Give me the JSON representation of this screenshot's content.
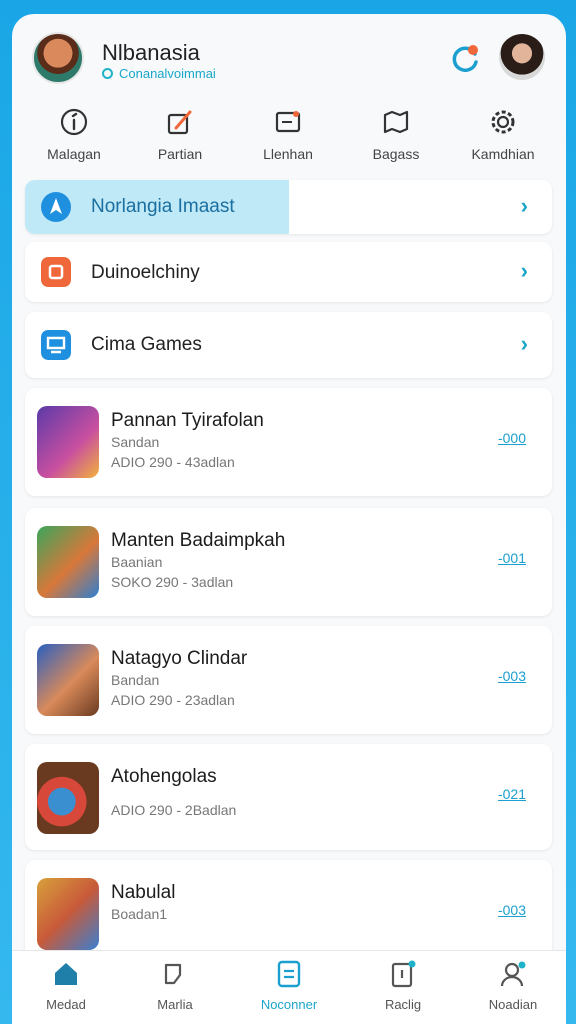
{
  "header": {
    "title": "Nlbanasia",
    "subtitle": "Conanalvoimmai"
  },
  "topnav": [
    {
      "label": "Malagan",
      "icon": "info-icon"
    },
    {
      "label": "Partian",
      "icon": "edit-icon"
    },
    {
      "label": "Llenhan",
      "icon": "message-icon"
    },
    {
      "label": "Bagass",
      "icon": "map-icon"
    },
    {
      "label": "Kamdhian",
      "icon": "gear-icon"
    }
  ],
  "menu": [
    {
      "label": "Norlangia Imaast",
      "icon": "rocket-icon",
      "color": "#1f8fe0"
    },
    {
      "label": "Duinoelchiny",
      "icon": "square-icon",
      "color": "#f0683a"
    },
    {
      "label": "Cima Games",
      "icon": "screen-icon",
      "color": "#1f8fe0"
    }
  ],
  "games": [
    {
      "title": "Pannan Tyirafolan",
      "sub": "Sandan",
      "meta": "ADIO 290 - 43adlan",
      "value": "-000"
    },
    {
      "title": "Manten Badaimpkah",
      "sub": "Baanian",
      "meta": "SOKO 290 - 3adlan",
      "value": "-001"
    },
    {
      "title": "Natagyo Clindar",
      "sub": "Bandan",
      "meta": "ADIO 290 - 23adlan",
      "value": "-003"
    },
    {
      "title": "Atohengolas",
      "sub": "",
      "meta": "ADIO 290 - 2Badlan",
      "value": "-021"
    },
    {
      "title": "Nabulal",
      "sub": "Boadan1",
      "meta": "",
      "value": "-003"
    }
  ],
  "bottomnav": [
    {
      "label": "Medad",
      "icon": "home-icon"
    },
    {
      "label": "Marlia",
      "icon": "cards-icon"
    },
    {
      "label": "Noconner",
      "icon": "list-icon"
    },
    {
      "label": "Raclig",
      "icon": "tablet-icon"
    },
    {
      "label": "Noadian",
      "icon": "profile-icon"
    }
  ],
  "colors": {
    "accent": "#1aa6c9",
    "brand": "#1aa6e6"
  }
}
